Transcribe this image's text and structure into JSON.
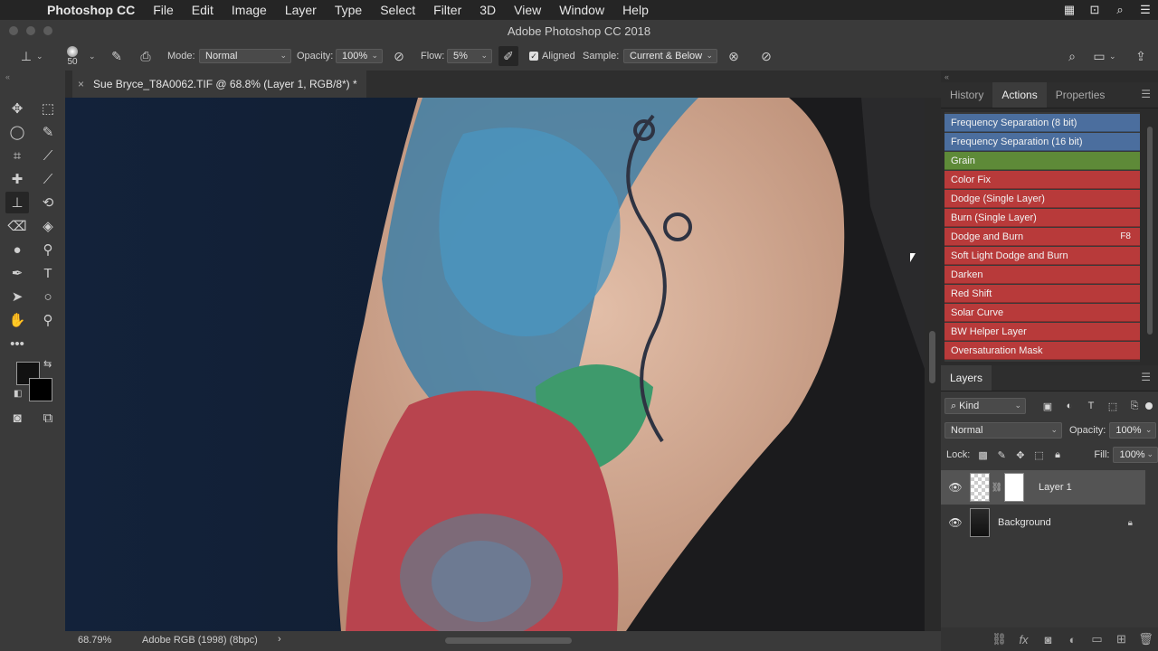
{
  "menubar": {
    "app_name": "Photoshop CC",
    "items": [
      "File",
      "Edit",
      "Image",
      "Layer",
      "Type",
      "Select",
      "Filter",
      "3D",
      "View",
      "Window",
      "Help"
    ]
  },
  "window": {
    "title": "Adobe Photoshop CC 2018"
  },
  "options": {
    "brush_size": "50",
    "mode_label": "Mode:",
    "mode_value": "Normal",
    "opacity_label": "Opacity:",
    "opacity_value": "100%",
    "flow_label": "Flow:",
    "flow_value": "5%",
    "aligned_label": "Aligned",
    "sample_label": "Sample:",
    "sample_value": "Current & Below"
  },
  "document": {
    "tab_title": "Sue Bryce_T8A0062.TIF @ 68.8% (Layer 1, RGB/8*) *"
  },
  "status": {
    "zoom": "68.79%",
    "profile": "Adobe RGB (1998) (8bpc)"
  },
  "panels": {
    "top_tabs": [
      "History",
      "Actions",
      "Properties"
    ],
    "actions": [
      {
        "name": "Frequency Separation (8 bit)",
        "color": "#4b6e9e",
        "key": ""
      },
      {
        "name": "Frequency Separation (16 bit)",
        "color": "#4b6e9e",
        "key": ""
      },
      {
        "name": "Grain",
        "color": "#5e8a38",
        "key": ""
      },
      {
        "name": "Color Fix",
        "color": "#b83a3a",
        "key": ""
      },
      {
        "name": "Dodge (Single Layer)",
        "color": "#b83a3a",
        "key": ""
      },
      {
        "name": "Burn (Single Layer)",
        "color": "#b83a3a",
        "key": ""
      },
      {
        "name": "Dodge and Burn",
        "color": "#b83a3a",
        "key": "F8"
      },
      {
        "name": "Soft Light Dodge and Burn",
        "color": "#b83a3a",
        "key": ""
      },
      {
        "name": "Darken",
        "color": "#b83a3a",
        "key": ""
      },
      {
        "name": "Red Shift",
        "color": "#b83a3a",
        "key": ""
      },
      {
        "name": "Solar Curve",
        "color": "#b83a3a",
        "key": ""
      },
      {
        "name": "BW Helper Layer",
        "color": "#b83a3a",
        "key": ""
      },
      {
        "name": "Oversaturation Mask",
        "color": "#b83a3a",
        "key": ""
      }
    ],
    "layers": {
      "tab": "Layers",
      "filter": "Kind",
      "blend_mode": "Normal",
      "opacity_label": "Opacity:",
      "opacity_value": "100%",
      "lock_label": "Lock:",
      "fill_label": "Fill:",
      "fill_value": "100%",
      "items": [
        {
          "name": "Layer 1"
        },
        {
          "name": "Background"
        }
      ]
    }
  }
}
